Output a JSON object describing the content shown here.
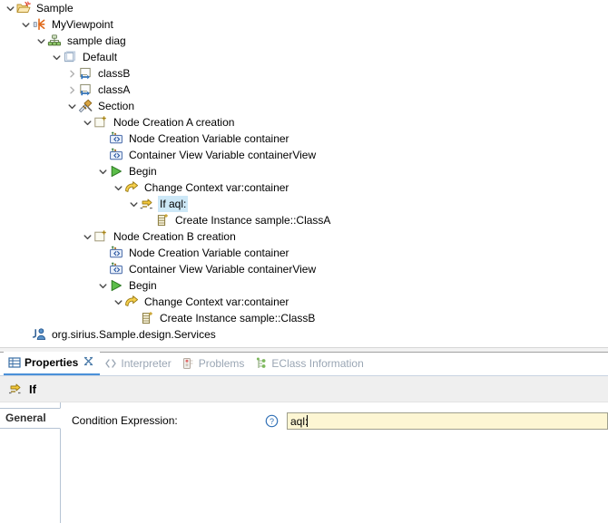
{
  "tree": {
    "name": "model-explorer-tree",
    "rows": [
      {
        "depth": 1,
        "twisty": "down",
        "icon": "folder-sample-icon",
        "label": "Sample",
        "selected": false
      },
      {
        "depth": 2,
        "twisty": "down",
        "icon": "viewpoint-icon",
        "label": "MyViewpoint",
        "selected": false
      },
      {
        "depth": 3,
        "twisty": "down",
        "icon": "diagram-icon",
        "label": "sample diag",
        "selected": false
      },
      {
        "depth": 4,
        "twisty": "down",
        "icon": "default-layer-icon",
        "label": "Default",
        "selected": false
      },
      {
        "depth": 5,
        "twisty": "right",
        "icon": "node-mapping-icon",
        "label": "classB",
        "selected": false
      },
      {
        "depth": 5,
        "twisty": "right",
        "icon": "node-mapping-icon",
        "label": "classA",
        "selected": false
      },
      {
        "depth": 5,
        "twisty": "down",
        "icon": "section-icon",
        "label": "Section",
        "selected": false
      },
      {
        "depth": 6,
        "twisty": "down",
        "icon": "node-creation-icon",
        "label": "Node Creation A creation",
        "selected": false
      },
      {
        "depth": 7,
        "twisty": "none",
        "icon": "variable-icon",
        "label": "Node Creation Variable container",
        "selected": false
      },
      {
        "depth": 7,
        "twisty": "none",
        "icon": "variable-icon",
        "label": "Container View Variable containerView",
        "selected": false
      },
      {
        "depth": 7,
        "twisty": "down",
        "icon": "begin-icon",
        "label": "Begin",
        "selected": false
      },
      {
        "depth": 8,
        "twisty": "down",
        "icon": "change-context-icon",
        "label": "Change Context var:container",
        "selected": false
      },
      {
        "depth": 9,
        "twisty": "down",
        "icon": "if-icon",
        "label": "If aql:",
        "selected": true
      },
      {
        "depth": 10,
        "twisty": "none",
        "icon": "create-instance-icon",
        "label": "Create Instance sample::ClassA",
        "selected": false
      },
      {
        "depth": 6,
        "twisty": "down",
        "icon": "node-creation-icon",
        "label": "Node Creation B creation",
        "selected": false
      },
      {
        "depth": 7,
        "twisty": "none",
        "icon": "variable-icon",
        "label": "Node Creation Variable container",
        "selected": false
      },
      {
        "depth": 7,
        "twisty": "none",
        "icon": "variable-icon",
        "label": "Container View Variable containerView",
        "selected": false
      },
      {
        "depth": 7,
        "twisty": "down",
        "icon": "begin-icon",
        "label": "Begin",
        "selected": false
      },
      {
        "depth": 8,
        "twisty": "down",
        "icon": "change-context-icon",
        "label": "Change Context var:container",
        "selected": false
      },
      {
        "depth": 9,
        "twisty": "none",
        "icon": "create-instance-icon",
        "label": "Create Instance sample::ClassB",
        "selected": false
      },
      {
        "depth": 2,
        "twisty": "none",
        "icon": "java-service-icon",
        "label": "org.sirius.Sample.design.Services",
        "selected": false
      }
    ]
  },
  "view_tabs": [
    {
      "label": "Properties",
      "icon": "properties-icon",
      "active": true,
      "closable": true
    },
    {
      "label": "Interpreter",
      "icon": "interpreter-icon",
      "active": false,
      "closable": false
    },
    {
      "label": "Problems",
      "icon": "problems-icon",
      "active": false,
      "closable": false
    },
    {
      "label": "EClass Information",
      "icon": "eclass-icon",
      "active": false,
      "closable": false
    }
  ],
  "properties": {
    "header_title": "If",
    "header_icon": "if-icon",
    "left_tabs": [
      {
        "label": "General",
        "active": true
      }
    ],
    "fields": [
      {
        "label": "Condition Expression:",
        "help_icon": "help-icon",
        "value": "aql:",
        "placeholder": ""
      }
    ]
  },
  "colors": {
    "selection": "#cde8f7",
    "expression_field_bg": "#fdf6d3",
    "header_bg": "#efefef",
    "accent": "#4a90d9",
    "inactive_tab_text": "#9aa6b4"
  }
}
